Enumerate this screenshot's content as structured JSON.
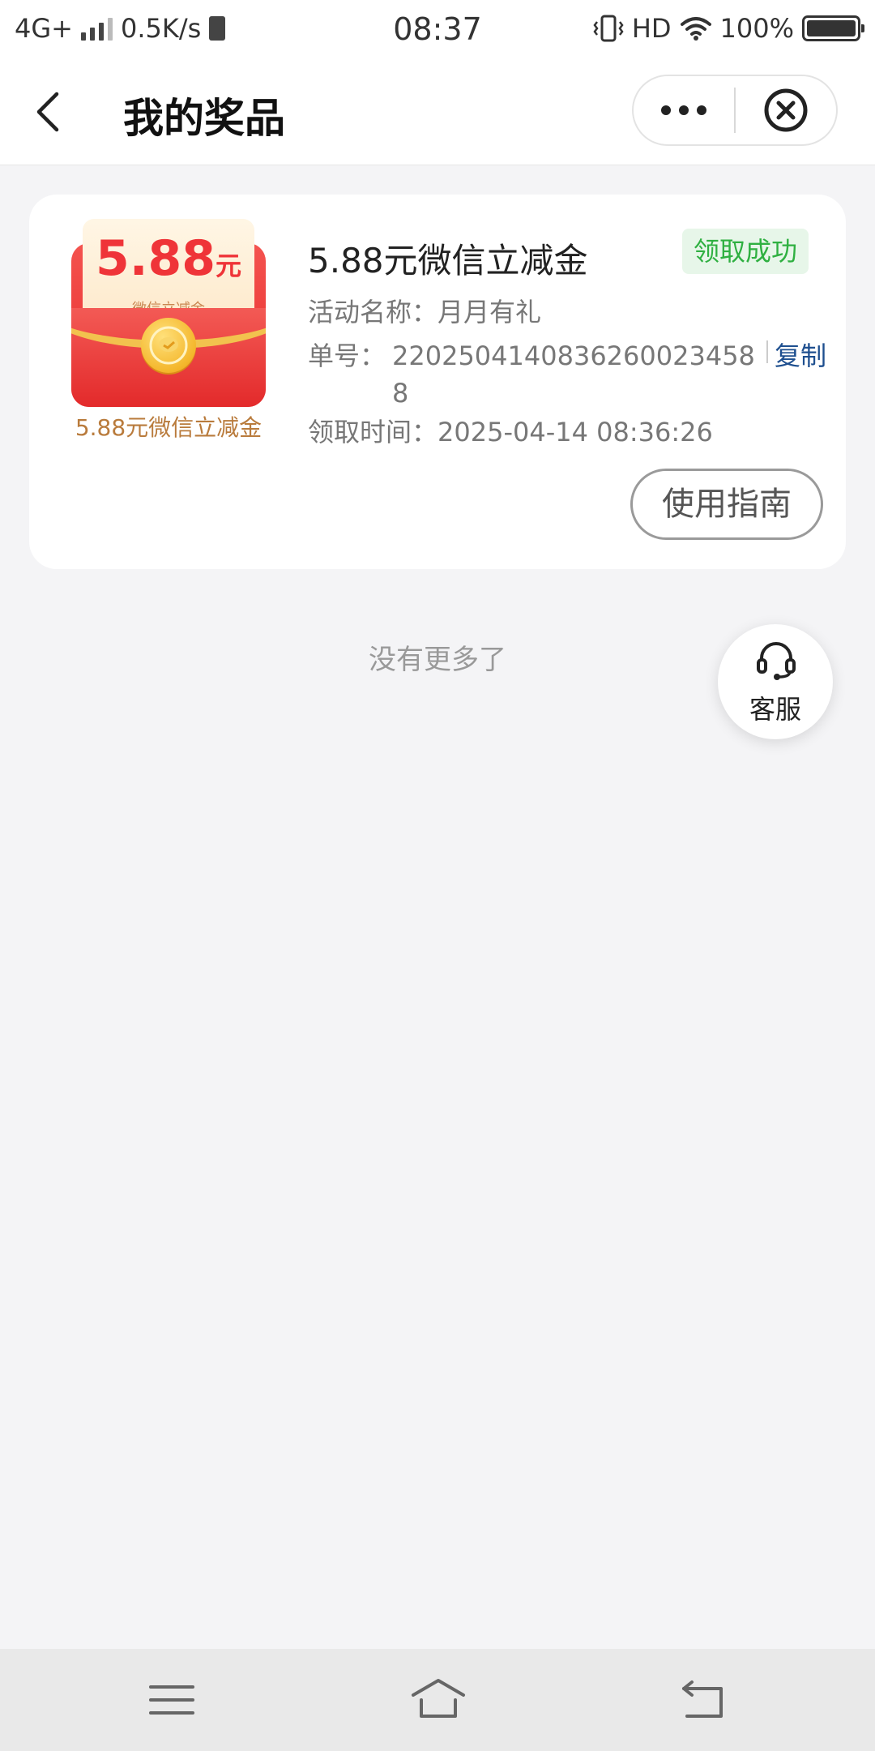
{
  "status_bar": {
    "network": "4G+",
    "speed": "0.5K/s",
    "time": "08:37",
    "hd": "HD",
    "battery": "100%"
  },
  "nav": {
    "title": "我的奖品",
    "back_icon": "chevron-left-icon",
    "more_icon": "more-dots-icon",
    "close_icon": "close-circle-icon"
  },
  "prize": {
    "image": {
      "amount": "5.88",
      "unit": "元",
      "subtitle": "— 微信立减金 —"
    },
    "caption": "5.88元微信立减金",
    "title": "5.88元微信立减金",
    "status": "领取成功",
    "activity_label": "活动名称：",
    "activity_value": "月月有礼",
    "order_label": "单号：",
    "order_value": "22025041408362600234588",
    "copy_label": "复制",
    "time_label": "领取时间：",
    "time_value": "2025-04-14 08:36:26",
    "guide_button": "使用指南",
    "colors": {
      "badge_bg": "#e7f6e9",
      "badge_text": "#2fb041",
      "copy": "#1e4f8f"
    }
  },
  "list_end": "没有更多了",
  "customer_service": {
    "label": "客服",
    "icon": "headset-icon"
  },
  "system_nav": {
    "menu_icon": "menu-icon",
    "home_icon": "home-icon",
    "back_icon": "back-icon"
  }
}
